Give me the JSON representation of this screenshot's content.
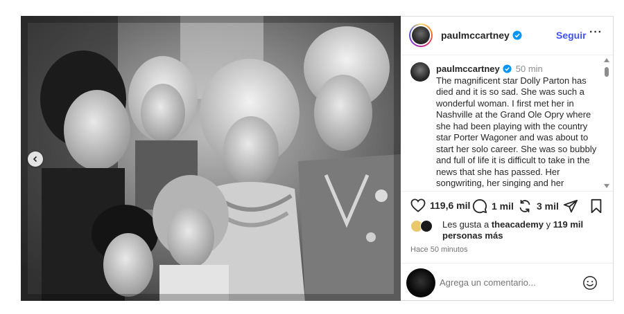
{
  "header": {
    "username": "paulmccartney",
    "follow_label": "Seguir",
    "more_label": "···"
  },
  "caption": {
    "username": "paulmccartney",
    "time": "50 min",
    "text": "The magnificent star Dolly Parton has died and it is so sad. She was such a wonderful woman. I first met her in Nashville at the Grand Ole Opry where she had been playing with the country star Porter Wagoner and was about to start her solo career. She was so bubbly and full of life it is difficult to take in the news that she has passed. Her songwriting, her singing and her"
  },
  "actions": {
    "likes_count": "119,6 mil",
    "comments_count": "1 mil",
    "reposts_count": "3 mil"
  },
  "likes": {
    "prefix": "Les gusta a",
    "user": "theacademy",
    "conjunction": "y",
    "others": "119 mil personas más"
  },
  "timestamp": "Hace 50 minutos",
  "comment": {
    "placeholder": "Agrega un comentario..."
  },
  "colors": {
    "follow_blue": "#4150f7",
    "verified_blue": "#0095f6",
    "muted": "#8e8e8e"
  },
  "icons": {
    "like": "heart-icon",
    "comment": "comment-icon",
    "repost": "repost-icon",
    "share": "send-icon",
    "save": "bookmark-icon",
    "emoji": "emoji-icon",
    "verified": "verified-badge-icon",
    "carousel_prev": "chevron-left-icon"
  }
}
